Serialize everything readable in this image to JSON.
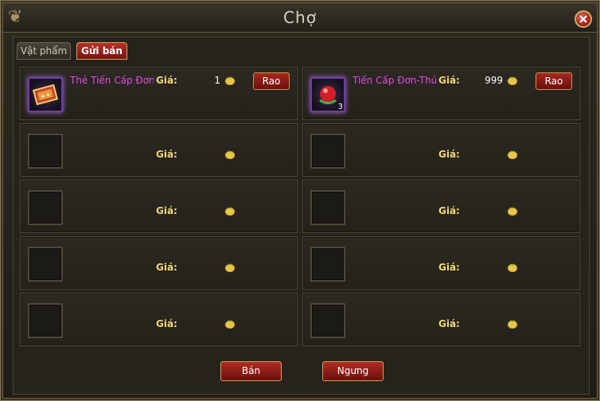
{
  "window": {
    "title": "Chợ"
  },
  "tabs": [
    {
      "label": "Vật phẩm"
    },
    {
      "label": "Gửi bán"
    }
  ],
  "price_label": "Giá:",
  "listings": [
    {
      "name": "Thẻ Tiến Cấp Đơn",
      "price": "1",
      "action": "Rao",
      "icon": "card-scroll-icon"
    },
    {
      "name": "Tiến Cấp Đơn-Thú",
      "price": "999",
      "action": "Rao",
      "icon": "red-pill-icon",
      "qty": "3"
    }
  ],
  "buttons": {
    "sell": "Bán",
    "stop": "Ngưng"
  },
  "colors": {
    "item_name": "#e04ae2",
    "price_label": "#f1d77c",
    "button": "#a5281f"
  }
}
